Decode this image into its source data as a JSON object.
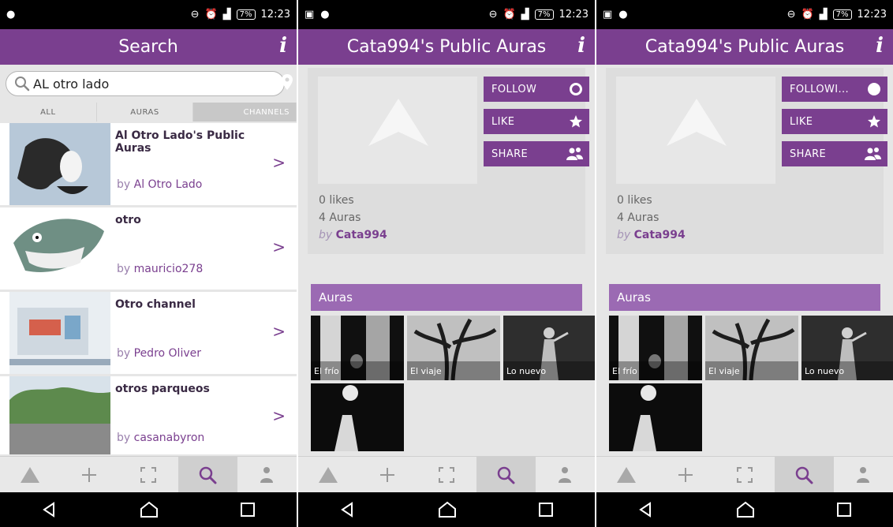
{
  "status": {
    "time": "12:23",
    "battery": "7%"
  },
  "search": {
    "title": "Search",
    "info": "i",
    "query": "AL otro lado",
    "tabs": [
      "ALL",
      "AURAS",
      "CHANNELS"
    ],
    "results": [
      {
        "title": "Al Otro Lado's Public Auras",
        "by": "by",
        "author": "Al Otro Lado"
      },
      {
        "title": "otro",
        "by": "by",
        "author": "mauricio278"
      },
      {
        "title": "Otro channel",
        "by": "by",
        "author": "Pedro Oliver"
      },
      {
        "title": "otros parqueos",
        "by": "by",
        "author": "casanabyron"
      }
    ]
  },
  "profile": {
    "title": "Cata994's Public Auras",
    "info": "i",
    "follow": "FOLLOW",
    "following": "FOLLOWI...",
    "like": "LIKE",
    "share": "SHARE",
    "likes": "0 likes",
    "auras_count": "4 Auras",
    "by": "by",
    "author": "Cata994",
    "auras_header": "Auras",
    "auras": [
      "El frío",
      "El viaje",
      "Lo nuevo"
    ]
  },
  "colors": {
    "purple": "#7a3f8f",
    "light_purple": "#9b6ab3"
  }
}
